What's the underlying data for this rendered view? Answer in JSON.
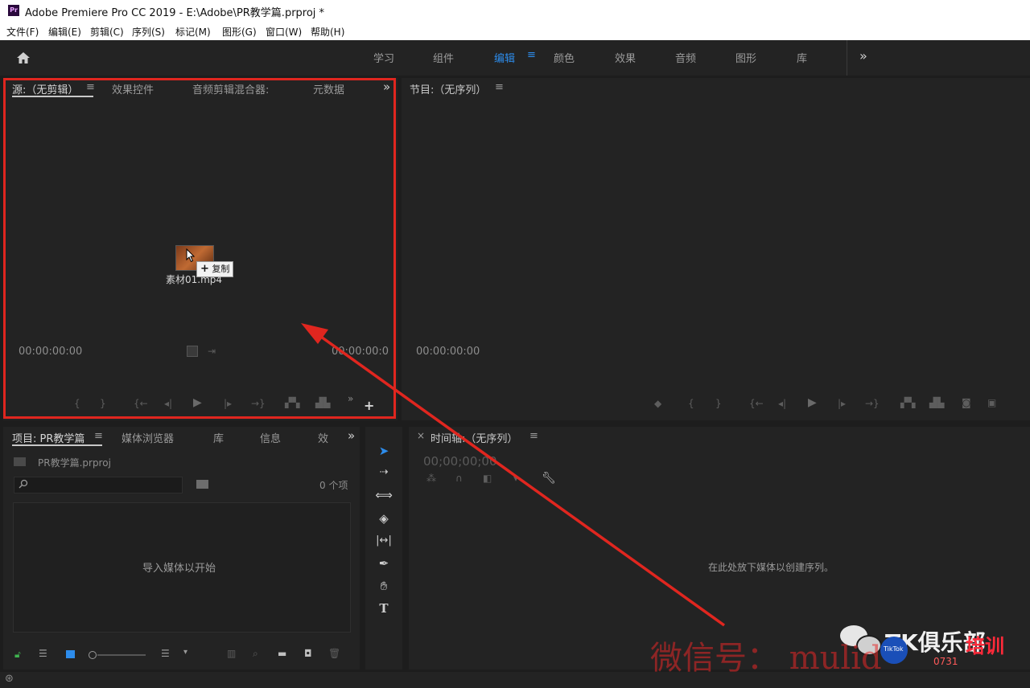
{
  "window": {
    "title": "Adobe Premiere Pro CC 2019 - E:\\Adobe\\PR教学篇.prproj *",
    "app_icon": "Pr"
  },
  "menu": [
    "文件(F)",
    "编辑(E)",
    "剪辑(C)",
    "序列(S)",
    "标记(M)",
    "图形(G)",
    "窗口(W)",
    "帮助(H)"
  ],
  "workspaces": {
    "items": [
      "学习",
      "组件",
      "编辑",
      "颜色",
      "效果",
      "音频",
      "图形",
      "库"
    ],
    "active": "编辑",
    "more": "»"
  },
  "source_panel": {
    "tabs": [
      "源:（无剪辑）",
      "效果控件",
      "音频剪辑混合器:",
      "元数据"
    ],
    "timecode_left": "00:00:00:00",
    "timecode_right": "00:00:00:0",
    "drag": {
      "filename": "素材01.mp4",
      "tooltip": "复制"
    }
  },
  "program_panel": {
    "title": "节目:（无序列）",
    "timecode": "00:00:00:00"
  },
  "project_panel": {
    "tabs": [
      "项目: PR教学篇",
      "媒体浏览器",
      "库",
      "信息",
      "效"
    ],
    "file": "PR教学篇.prproj",
    "count": "0 个项",
    "empty_text": "导入媒体以开始"
  },
  "timeline_panel": {
    "title": "时间轴:（无序列）",
    "timecode": "00;00;00;00",
    "empty_text": "在此处放下媒体以创建序列。"
  },
  "watermark": {
    "wechat": "微信号： mulid",
    "club": "TK俱乐部",
    "tiktok": "TikTok",
    "training": "培训",
    "site": "0731"
  },
  "colors": {
    "accent": "#2d8ceb",
    "annotation": "#e0261f"
  }
}
